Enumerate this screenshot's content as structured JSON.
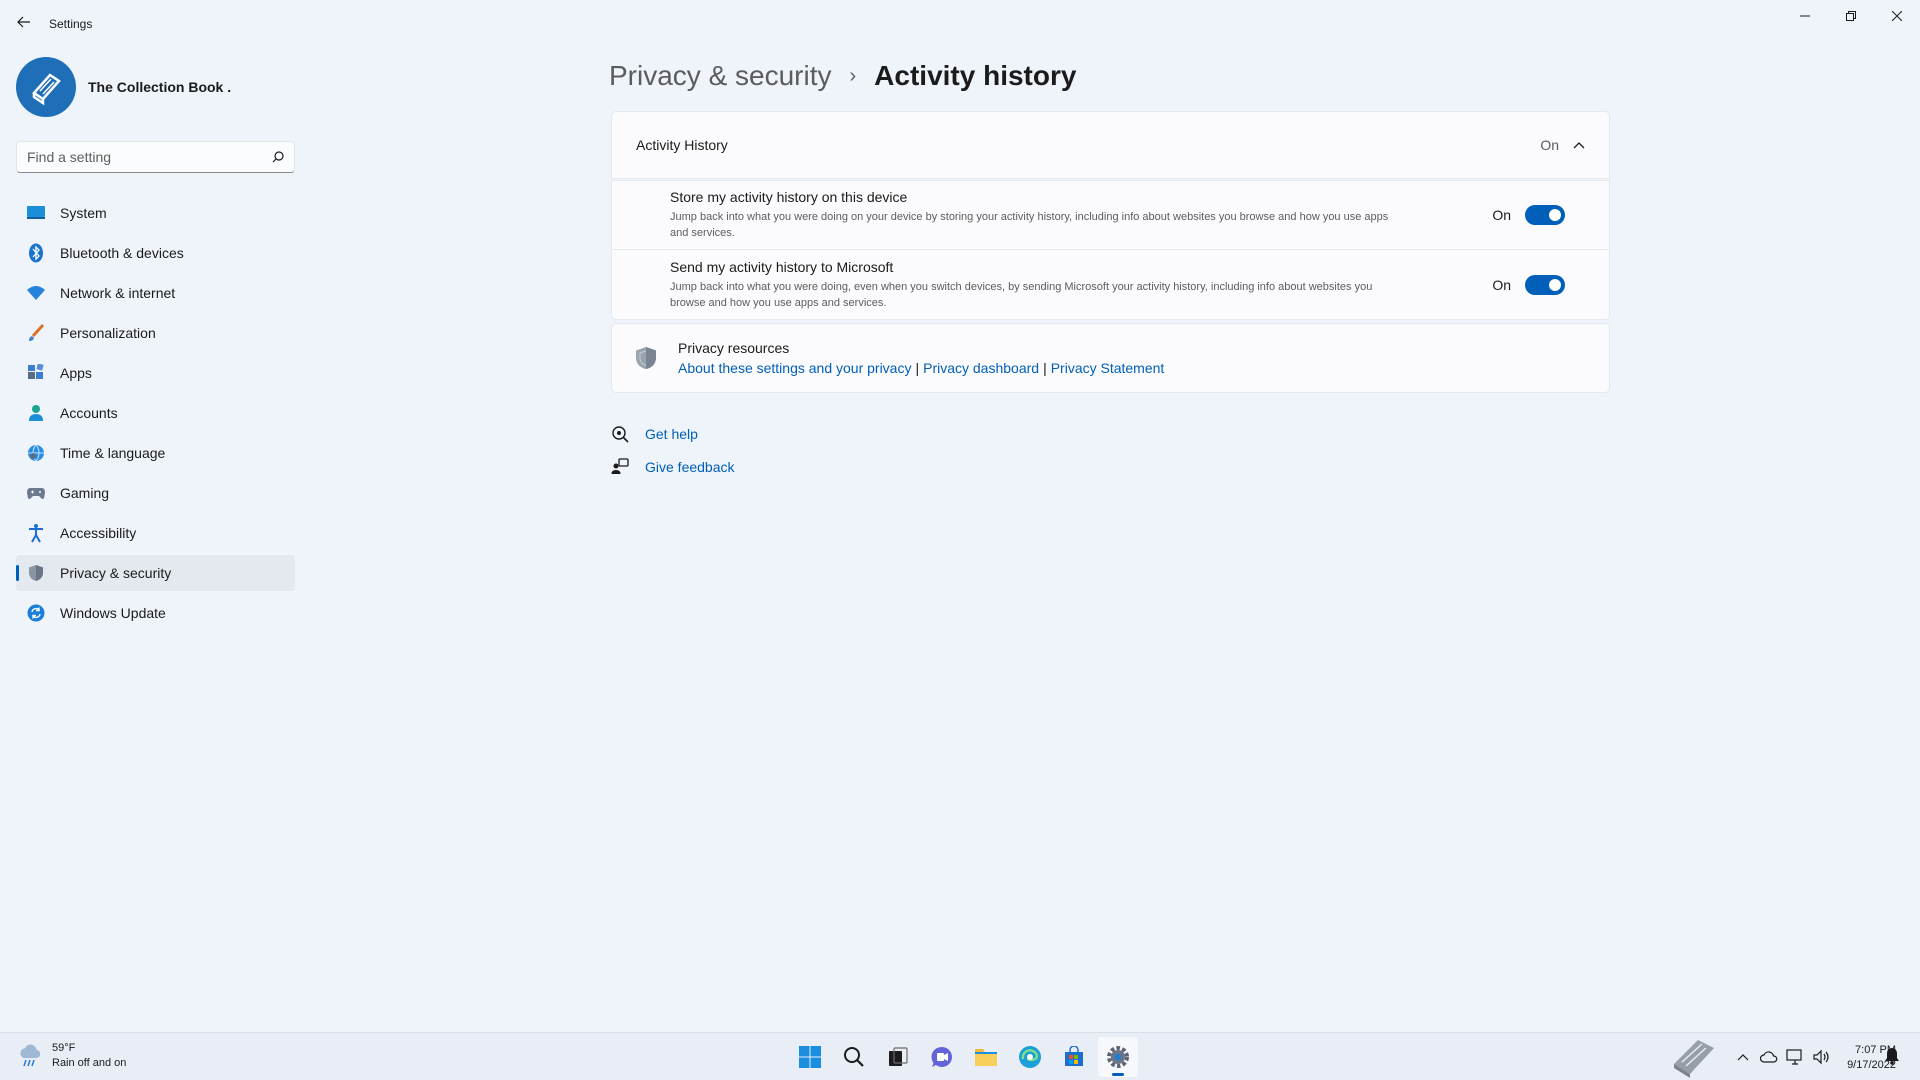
{
  "app": {
    "title": "Settings"
  },
  "profile": {
    "name": "The Collection Book ."
  },
  "search": {
    "placeholder": "Find a setting"
  },
  "sidebar": {
    "items": [
      {
        "label": "System",
        "icon": "system-icon"
      },
      {
        "label": "Bluetooth & devices",
        "icon": "bluetooth-icon"
      },
      {
        "label": "Network & internet",
        "icon": "wifi-icon"
      },
      {
        "label": "Personalization",
        "icon": "brush-icon"
      },
      {
        "label": "Apps",
        "icon": "apps-icon"
      },
      {
        "label": "Accounts",
        "icon": "accounts-icon"
      },
      {
        "label": "Time & language",
        "icon": "globe-icon"
      },
      {
        "label": "Gaming",
        "icon": "gamepad-icon"
      },
      {
        "label": "Accessibility",
        "icon": "accessibility-icon"
      },
      {
        "label": "Privacy & security",
        "icon": "shield-icon",
        "active": true
      },
      {
        "label": "Windows Update",
        "icon": "update-icon"
      }
    ]
  },
  "breadcrumb": {
    "parent": "Privacy & security",
    "separator": "›",
    "current": "Activity history"
  },
  "activity": {
    "header": {
      "title": "Activity History",
      "state": "On"
    },
    "store": {
      "title": "Store my activity history on this device",
      "description": "Jump back into what you were doing on your device by storing your activity history, including info about websites you browse and how you use apps and services.",
      "state": "On",
      "on": true
    },
    "send": {
      "title": "Send my activity history to Microsoft",
      "description": "Jump back into what you were doing, even when you switch devices, by sending Microsoft your activity history, including info about websites you browse and how you use apps and services.",
      "state": "On",
      "on": true
    }
  },
  "privacy_resources": {
    "title": "Privacy resources",
    "links": [
      "About these settings and your privacy",
      "Privacy dashboard",
      "Privacy Statement"
    ],
    "separator": "|"
  },
  "help": {
    "get_help": "Get help",
    "give_feedback": "Give feedback"
  },
  "taskbar": {
    "weather": {
      "temp": "59°F",
      "condition": "Rain off and on"
    },
    "clock": {
      "time": "7:07 PM",
      "date": "9/17/2022"
    }
  },
  "colors": {
    "accent": "#005fb8",
    "background": "#eff3fa",
    "card": "#fbfbfd"
  }
}
